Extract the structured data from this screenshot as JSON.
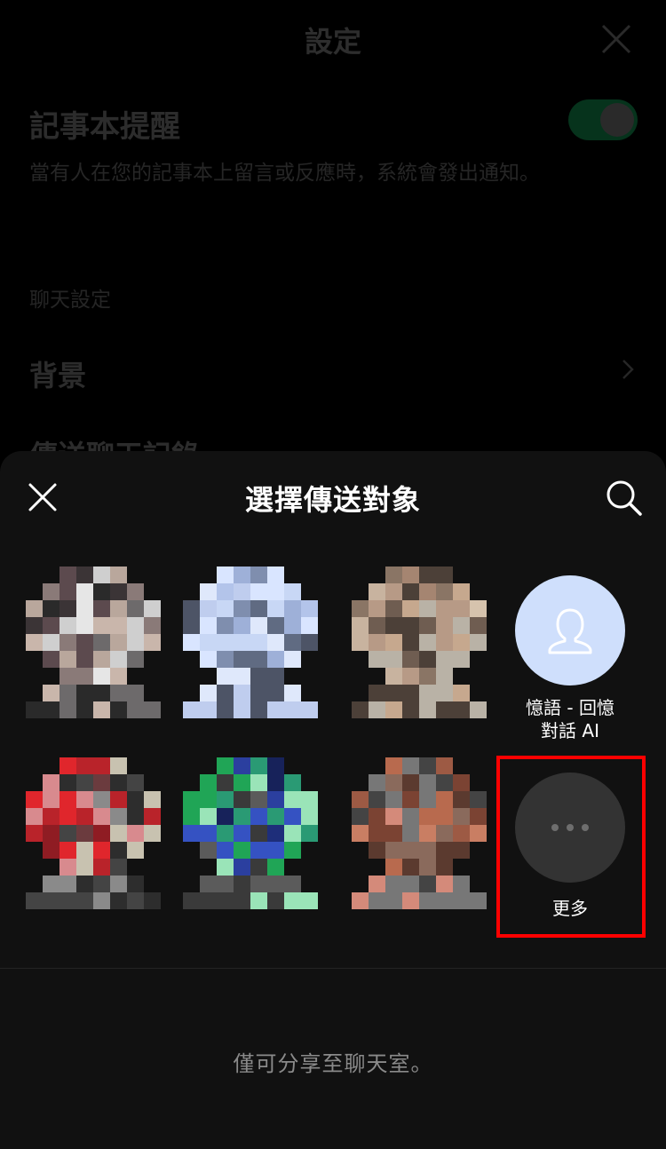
{
  "background": {
    "title": "設定",
    "memo_reminder_title": "記事本提醒",
    "memo_reminder_desc": "當有人在您的記事本上留言或反應時，系統會發出通知。",
    "chat_settings_section": "聊天設定",
    "background_label": "背景",
    "send_chat_history_label": "傳送聊天記錄"
  },
  "sheet": {
    "title": "選擇傳送對象",
    "close_icon": "close-icon",
    "search_icon": "search-icon",
    "footer_text": "僅可分享至聊天室。"
  },
  "targets": [
    {
      "label": "",
      "avatar": "blurred"
    },
    {
      "label": "",
      "avatar": "blurred"
    },
    {
      "label": "",
      "avatar": "blurred"
    },
    {
      "label_line1": "憶語 - 回憶",
      "label_line2": "對話 AI",
      "avatar": "person-icon"
    },
    {
      "label": "",
      "avatar": "blurred"
    },
    {
      "label": "",
      "avatar": "blurred"
    },
    {
      "label": "",
      "avatar": "blurred"
    },
    {
      "label": "更多",
      "avatar": "more-icon"
    }
  ],
  "colors": {
    "sheet_bg": "#111111",
    "person_avatar_bg": "#cfdffc",
    "more_avatar_bg": "#333333",
    "highlight": "#ff0000",
    "footer_text": "#8a8a8a"
  }
}
